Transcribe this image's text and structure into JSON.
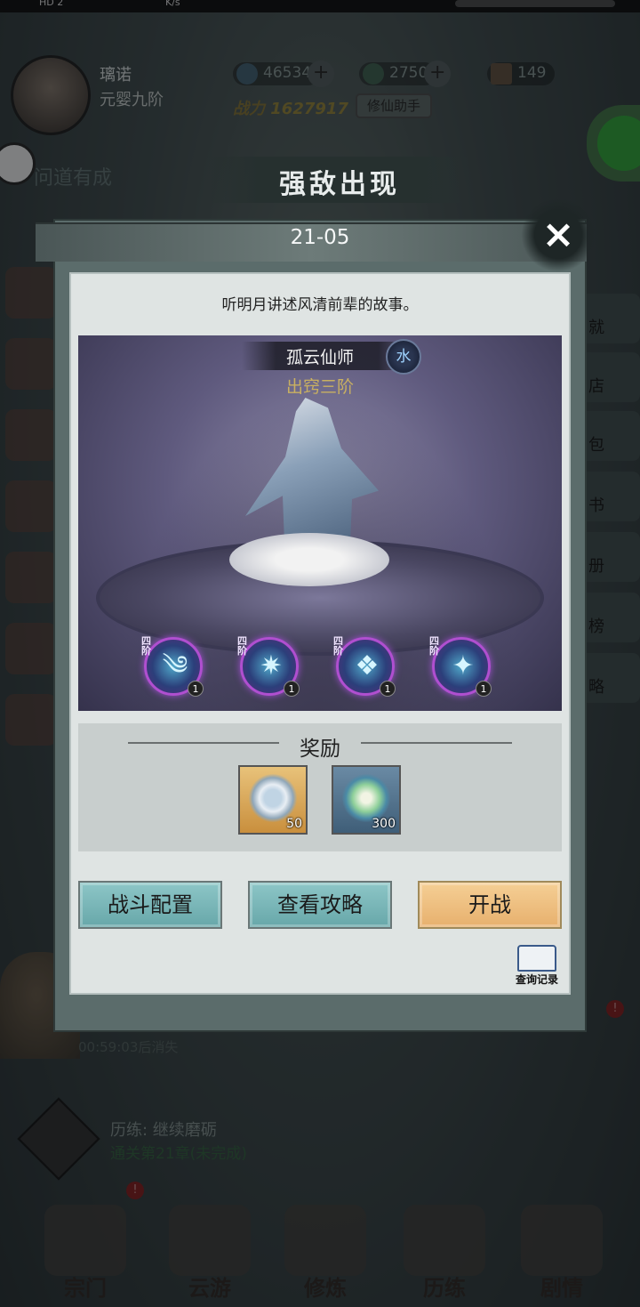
{
  "status_bar": {
    "left_label": "HD 2",
    "speed": "K/s"
  },
  "player": {
    "name": "璃诺",
    "rank": "元婴九阶",
    "spirit_stones": "46534",
    "jade": "2750",
    "scrolls": "149",
    "power_label": "战力",
    "power_value": "1627917",
    "helper_button": "修仙助手"
  },
  "banner_text": "问道有成",
  "right_menu": [
    "就",
    "店",
    "包",
    "书",
    "册",
    "榜",
    "略"
  ],
  "timer_text": "00:59:03后消失",
  "experience": {
    "title": "历练: 继续磨砺",
    "subtitle": "通关第21章(未完成)"
  },
  "bottom_nav": [
    {
      "label": "宗门"
    },
    {
      "label": "云游"
    },
    {
      "label": "修炼"
    },
    {
      "label": "历练"
    },
    {
      "label": "剧情"
    }
  ],
  "badge_text": "!",
  "dialog": {
    "header_title": "强敌出现",
    "level": "21-05",
    "close_icon": "×",
    "description": "听明月讲述风清前辈的故事。",
    "boss_name": "孤云仙师",
    "boss_element": "水",
    "boss_realm": "出窍三阶",
    "skills": [
      {
        "tier": "四阶",
        "level": "1",
        "icon": "wind-swirl-icon",
        "glyph": "༄"
      },
      {
        "tier": "四阶",
        "level": "1",
        "icon": "ice-burst-icon",
        "glyph": "✷"
      },
      {
        "tier": "四阶",
        "level": "1",
        "icon": "ice-shard-icon",
        "glyph": "❖"
      },
      {
        "tier": "四阶",
        "level": "1",
        "icon": "ice-crystal-icon",
        "glyph": "✦"
      }
    ],
    "reward_title": "奖励",
    "rewards": [
      {
        "icon": "jade-ring-icon",
        "count": "50"
      },
      {
        "icon": "spirit-swirl-icon",
        "count": "300"
      }
    ],
    "buttons": {
      "battle_config": "战斗配置",
      "view_guide": "查看攻略",
      "start_battle": "开战"
    },
    "record_label": "查询记录"
  },
  "colors": {
    "accent_teal": "#7ab8b9",
    "accent_orange": "#efc083",
    "realm_gold": "#c9b061",
    "skill_border_purple": "#b04fd0"
  }
}
